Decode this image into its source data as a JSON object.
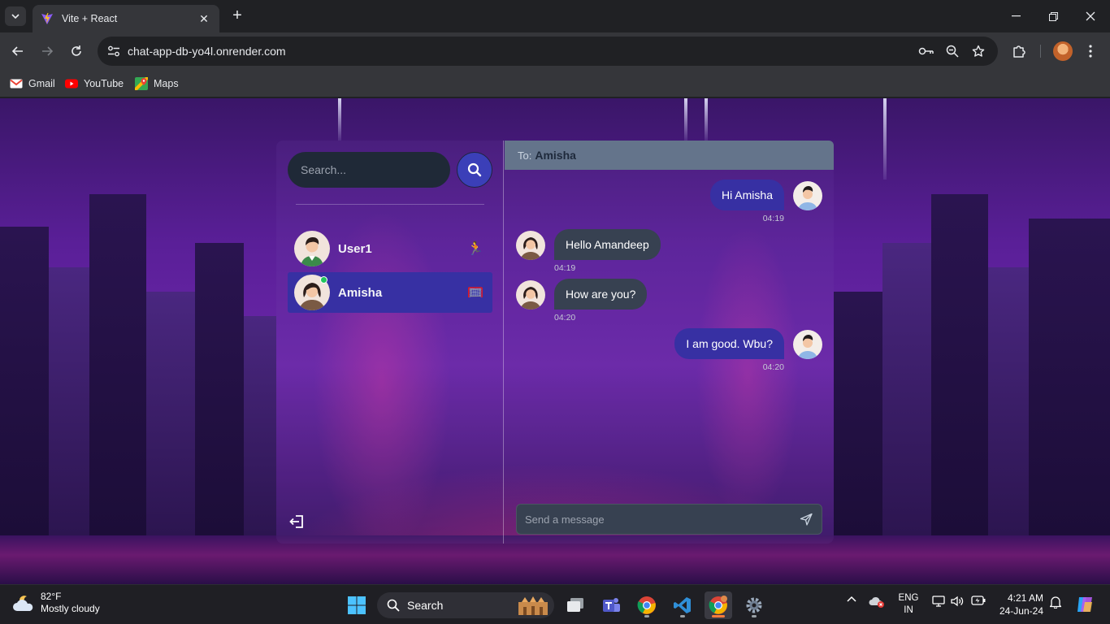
{
  "browser": {
    "tab": {
      "title": "Vite + React"
    },
    "url": "chat-app-db-yo4l.onrender.com",
    "bookmarks": [
      {
        "label": "Gmail",
        "icon": "gmail-icon"
      },
      {
        "label": "YouTube",
        "icon": "youtube-icon"
      },
      {
        "label": "Maps",
        "icon": "maps-icon"
      }
    ]
  },
  "app": {
    "search_placeholder": "Search...",
    "conversations": [
      {
        "name": "User1",
        "emoji": "🏃",
        "online": false,
        "selected": false
      },
      {
        "name": "Amisha",
        "emoji": "🥅",
        "online": true,
        "selected": true
      }
    ],
    "chat": {
      "to_label": "To:",
      "recipient": "Amisha",
      "messages": [
        {
          "text": "Hi Amisha",
          "time": "04:19",
          "from_me": true
        },
        {
          "text": "Hello Amandeep",
          "time": "04:19",
          "from_me": false
        },
        {
          "text": "How are you?",
          "time": "04:20",
          "from_me": false
        },
        {
          "text": "I am good. Wbu?",
          "time": "04:20",
          "from_me": true
        }
      ],
      "composer_placeholder": "Send a message"
    },
    "colors": {
      "accent": "#3730a3",
      "search_button": "#3b3fb8",
      "header": "#64748b",
      "incoming_bubble": "#374151",
      "online": "#22c55e"
    }
  },
  "taskbar": {
    "weather": {
      "temp": "82°F",
      "condition": "Mostly cloudy"
    },
    "search_label": "Search",
    "language": {
      "line1": "ENG",
      "line2": "IN"
    },
    "clock": {
      "time": "4:21 AM",
      "date": "24-Jun-24"
    }
  }
}
